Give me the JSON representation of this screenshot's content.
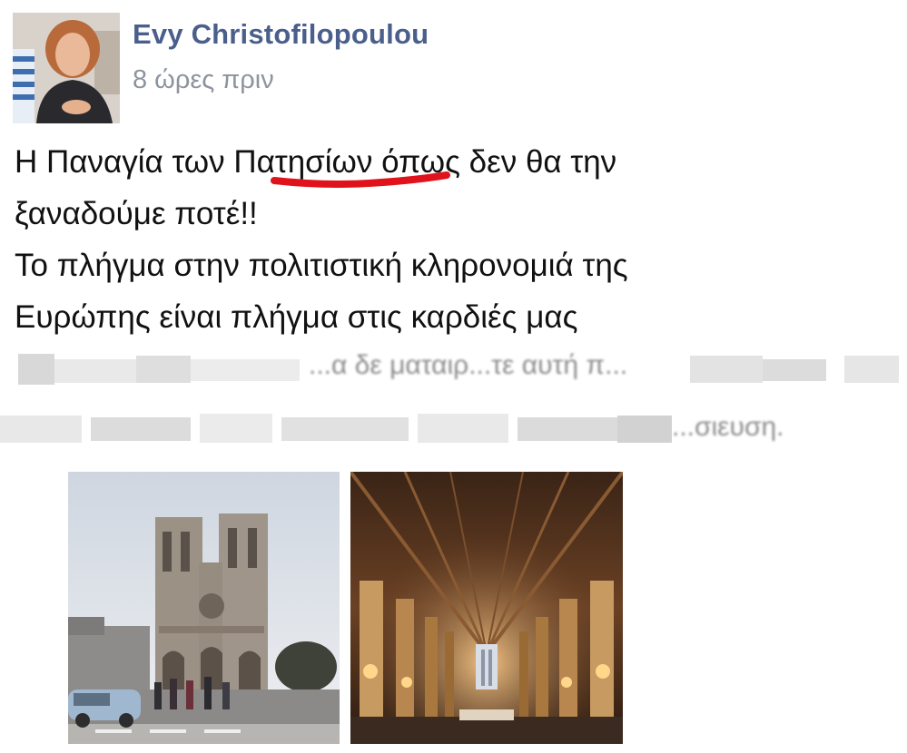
{
  "post": {
    "author_name": "Evy Christofilopoulou",
    "timestamp": "8 ώρες πριν",
    "text": {
      "line1_before": "Η Παναγία των ",
      "line1_underlined": "Πατησίων",
      "line1_after": " όπως δεν θα την",
      "line2": "ξαναδούμε ποτέ!!",
      "line3": "Το πλήγμα στην πολιτιστική κληρονομιά της",
      "line4": "Ευρώπης είναι πλήγμα στις καρδιές μας"
    },
    "blurred": {
      "line1_fragment": "...α δε ματαιρ...τε αυτή π...",
      "line2_fragment": "...σιευση."
    },
    "photos": [
      {
        "icon": "notre-dame-exterior-photo"
      },
      {
        "icon": "notre-dame-interior-photo"
      }
    ],
    "colors": {
      "author": "#4b5f8c",
      "timestamp": "#8d949e",
      "underline": "#e0121b"
    }
  }
}
